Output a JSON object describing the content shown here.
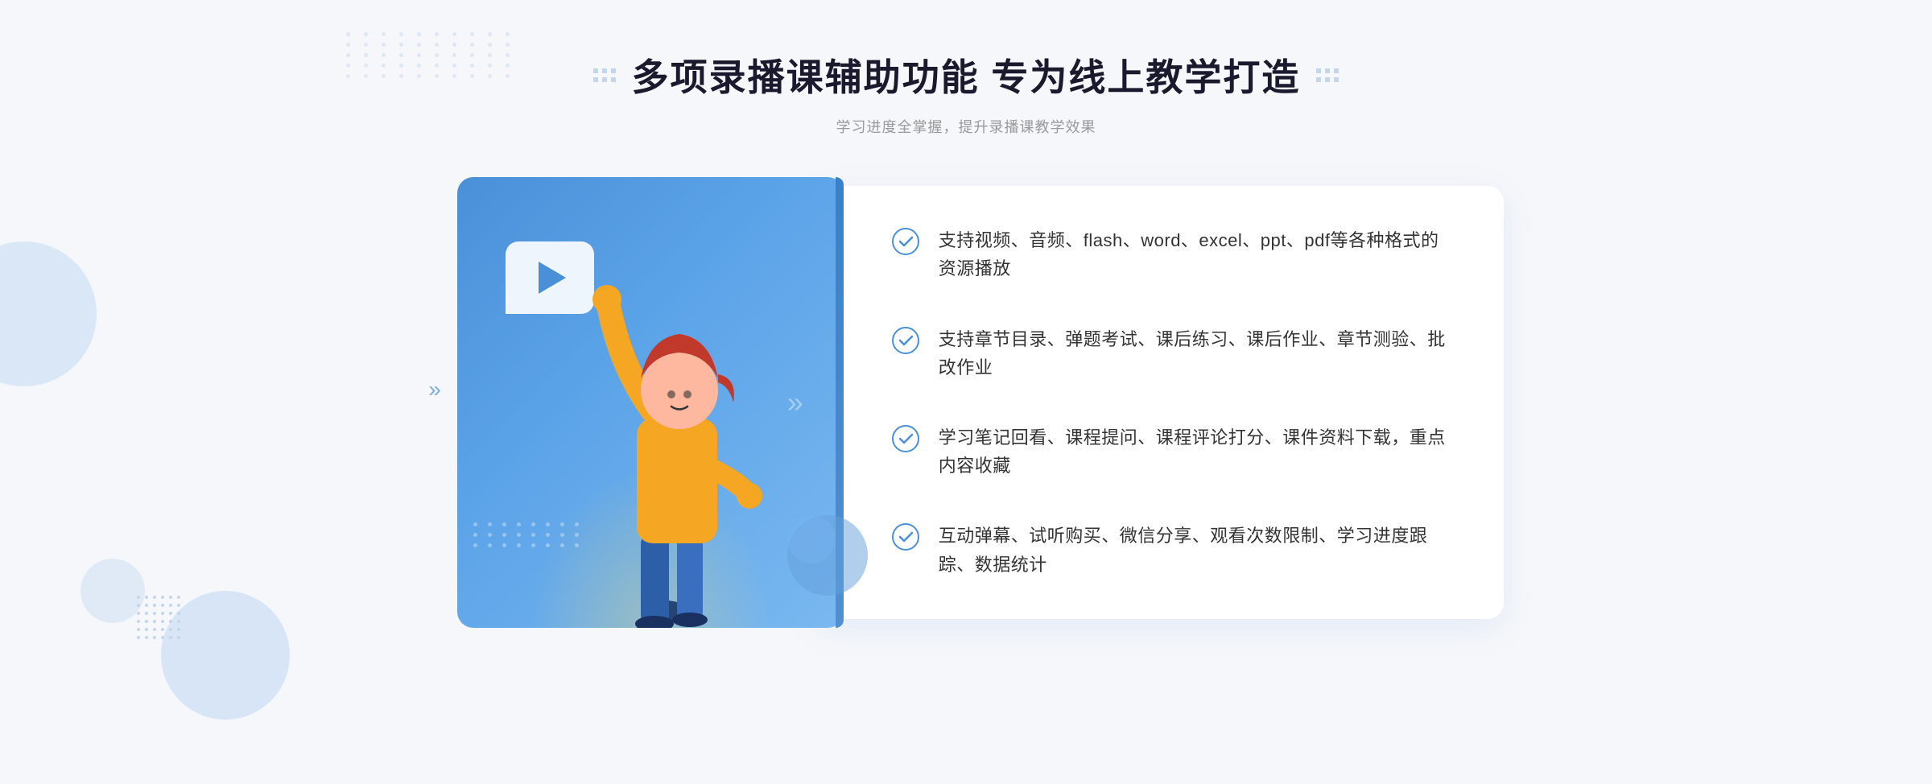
{
  "header": {
    "main_title": "多项录播课辅助功能 专为线上教学打造",
    "sub_title": "学习进度全掌握，提升录播课教学效果"
  },
  "features": [
    {
      "id": "feature-1",
      "text": "支持视频、音频、flash、word、excel、ppt、pdf等各种格式的资源播放"
    },
    {
      "id": "feature-2",
      "text": "支持章节目录、弹题考试、课后练习、课后作业、章节测验、批改作业"
    },
    {
      "id": "feature-3",
      "text": "学习笔记回看、课程提问、课程评论打分、课件资料下载，重点内容收藏"
    },
    {
      "id": "feature-4",
      "text": "互动弹幕、试听购买、微信分享、观看次数限制、学习进度跟踪、数据统计"
    }
  ],
  "decorations": {
    "left_arrow": "»",
    "right_chevron": "»"
  },
  "colors": {
    "primary_blue": "#4a90d9",
    "light_blue": "#e8f2fb",
    "text_dark": "#333333",
    "text_gray": "#999999",
    "check_color": "#4a90d9"
  }
}
